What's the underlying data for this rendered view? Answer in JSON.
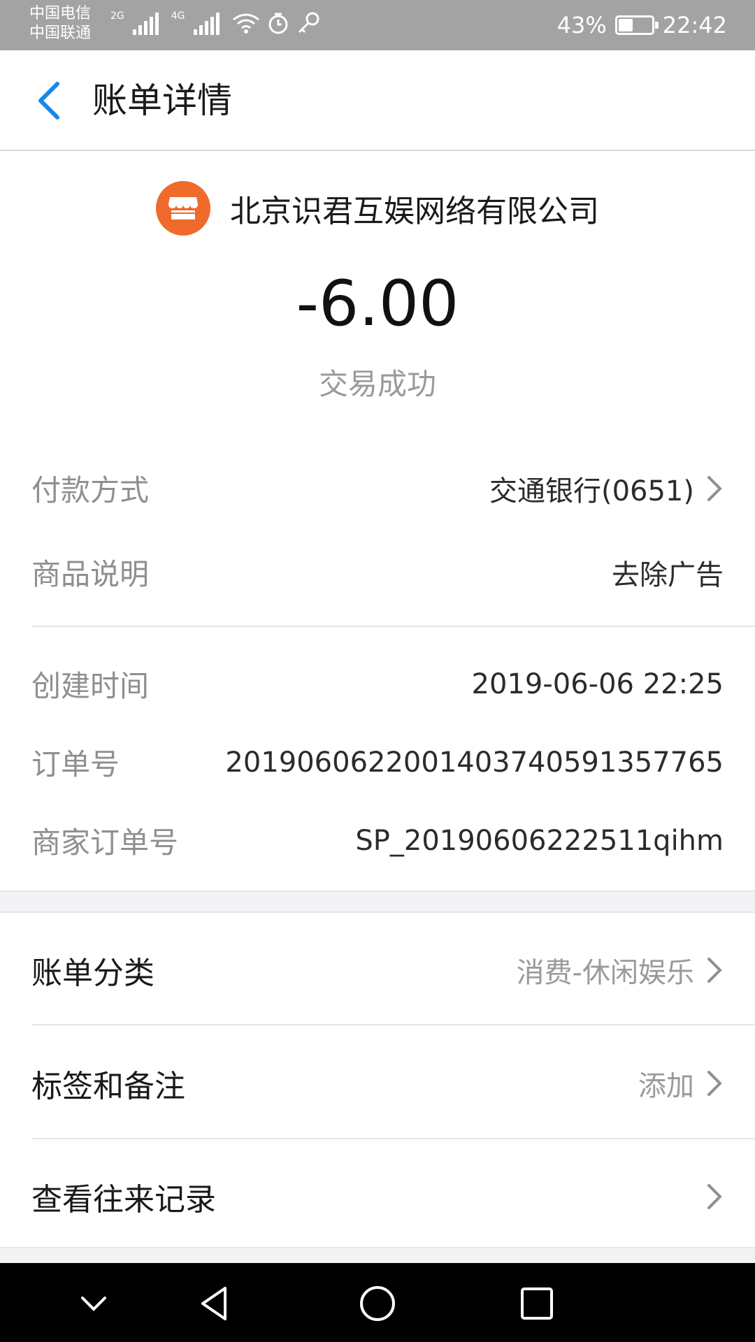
{
  "status_bar": {
    "carrier_1": "中国电信",
    "carrier_2": "中国联通",
    "net_1": "2G",
    "net_2": "4G",
    "battery_text": "43%",
    "battery_level": 0.43,
    "time": "22:42"
  },
  "header": {
    "title": "账单详情"
  },
  "merchant": {
    "name": "北京识君互娱网络有限公司",
    "logo_color": "#ef6a2b"
  },
  "transaction": {
    "amount": "-6.00",
    "status": "交易成功"
  },
  "details": [
    {
      "label": "付款方式",
      "value": "交通银行(0651)"
    },
    {
      "label": "商品说明",
      "value": "去除广告"
    },
    {
      "label": "创建时间",
      "value": "2019-06-06 22:25"
    },
    {
      "label": "订单号",
      "value": "2019060622001403740591357765"
    },
    {
      "label": "商家订单号",
      "value": "SP_20190606222511qihm"
    }
  ],
  "menu": [
    {
      "label": "账单分类",
      "value": "消费-休闲娱乐"
    },
    {
      "label": "标签和备注",
      "value": "添加"
    },
    {
      "label": "查看往来记录",
      "value": ""
    }
  ],
  "colors": {
    "accent": "#1a88e6",
    "status_bar": "#a3a3a3"
  }
}
